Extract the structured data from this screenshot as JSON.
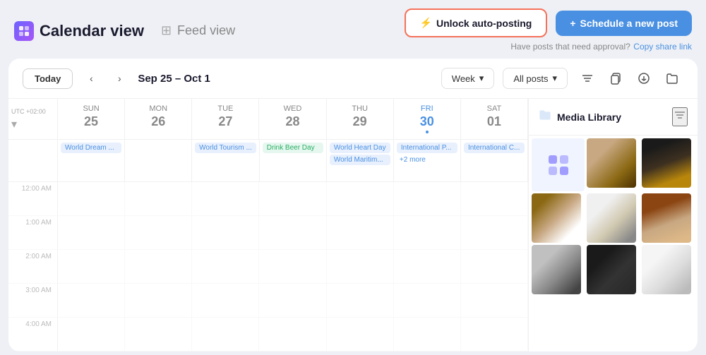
{
  "header": {
    "logo_icon": "B",
    "calendar_view_label": "Calendar view",
    "feed_view_label": "Feed view",
    "unlock_btn_label": "Unlock auto-posting",
    "schedule_btn_label": "Schedule a new post",
    "approval_text": "Have posts that need approval?",
    "copy_link_label": "Copy share link"
  },
  "toolbar": {
    "today_label": "Today",
    "date_range": "Sep 25 – Oct 1",
    "week_label": "Week",
    "all_posts_label": "All posts"
  },
  "calendar": {
    "timezone": "UTC +02:00",
    "days": [
      {
        "name": "Sun",
        "number": "25",
        "today": false
      },
      {
        "name": "Mon",
        "number": "26",
        "today": false
      },
      {
        "name": "Tue",
        "number": "27",
        "today": false
      },
      {
        "name": "Wed",
        "number": "28",
        "today": false
      },
      {
        "name": "Thu",
        "number": "29",
        "today": false
      },
      {
        "name": "Fri",
        "number": "30",
        "today": true
      },
      {
        "name": "Sat",
        "number": "01",
        "today": false
      }
    ],
    "events": {
      "sun25": [
        "World Dream ..."
      ],
      "mon26": [],
      "tue27": [
        "World Tourism ..."
      ],
      "wed28": [
        "Drink Beer Day"
      ],
      "thu29": [
        "World Heart Day",
        "World Maritim..."
      ],
      "fri30": [
        "International P...",
        "+2 more"
      ],
      "sat01": [
        "International C..."
      ]
    },
    "time_slots": [
      "12:00 AM",
      "1:00 AM",
      "2:00 AM",
      "3:00 AM",
      "4:00 AM"
    ]
  },
  "media_library": {
    "title": "Media Library",
    "images": [
      {
        "id": 1,
        "style": "placeholder-logo"
      },
      {
        "id": 2,
        "style": "dog-1"
      },
      {
        "id": 3,
        "style": "dog-2"
      },
      {
        "id": 4,
        "style": "dog-3"
      },
      {
        "id": 5,
        "style": "dog-4"
      },
      {
        "id": 6,
        "style": "dog-5"
      },
      {
        "id": 7,
        "style": "dog-6"
      },
      {
        "id": 8,
        "style": "dog-7"
      },
      {
        "id": 9,
        "style": "dog-8"
      },
      {
        "id": 10,
        "style": "dog-9"
      }
    ]
  }
}
